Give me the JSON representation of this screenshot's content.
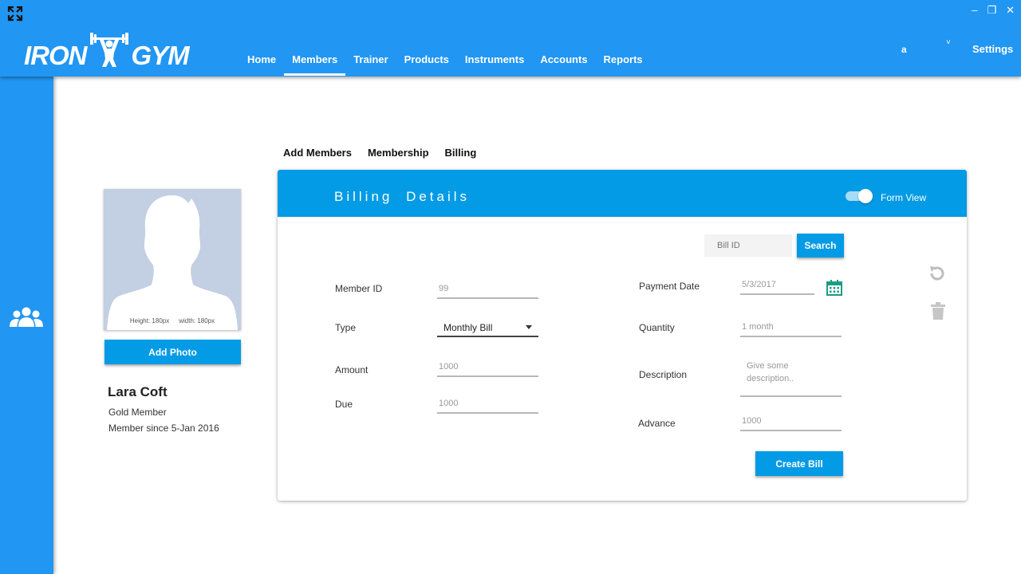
{
  "window": {
    "minimize": "–",
    "restore": "❐",
    "close": "✕"
  },
  "brand": {
    "logo_left": "IRON",
    "logo_right": "GYM",
    "accent_color": "#2196F3",
    "header_color": "#039BE5"
  },
  "nav": {
    "items": [
      {
        "label": "Home"
      },
      {
        "label": "Members"
      },
      {
        "label": "Trainer"
      },
      {
        "label": "Products"
      },
      {
        "label": "Instruments"
      },
      {
        "label": "Accounts"
      },
      {
        "label": "Reports"
      }
    ],
    "active": "Members"
  },
  "user": {
    "name": "a",
    "caret": "˅",
    "settings_label": "Settings"
  },
  "sidebar": {
    "icon": "members-group-icon"
  },
  "profile": {
    "photo_height_caption": "Height: 180px",
    "photo_width_caption": "width: 180px",
    "add_photo_label": "Add Photo",
    "name": "Lara Coft",
    "level": "Gold Member",
    "since": "Member since 5-Jan 2016"
  },
  "tabs": [
    {
      "label": "Add Members"
    },
    {
      "label": "Membership"
    },
    {
      "label": "Billing"
    }
  ],
  "card": {
    "title": "Billing Details",
    "toggle_label": "Form View",
    "toggle_on": true,
    "bill_id_placeholder": "Bill ID",
    "search_label": "Search",
    "create_bill_label": "Create Bill"
  },
  "form": {
    "member_id": {
      "label": "Member ID",
      "placeholder": "99"
    },
    "type": {
      "label": "Type",
      "value": "Monthly Bill"
    },
    "amount": {
      "label": "Amount",
      "placeholder": "1000"
    },
    "due": {
      "label": "Due",
      "placeholder": "1000"
    },
    "payment_date": {
      "label": "Payment Date",
      "placeholder": "5/3/2017"
    },
    "quantity": {
      "label": "Quantity",
      "placeholder": "1 month"
    },
    "description": {
      "label": "Description",
      "placeholder": "Give some description.."
    },
    "advance": {
      "label": "Advance",
      "placeholder": "1000"
    }
  }
}
